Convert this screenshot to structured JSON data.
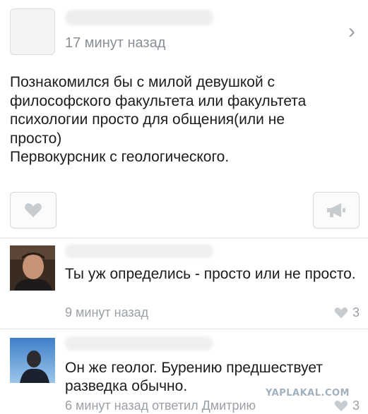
{
  "post": {
    "time": "17 минут назад",
    "text_lines": [
      "Познакомился бы с милой девушкой с",
      "философского факультета или факультета",
      "психологии просто для общения(или не",
      "просто)",
      "Первокурсник с геологического."
    ],
    "like_icon": "heart-icon",
    "share_icon": "megaphone-icon"
  },
  "comments": [
    {
      "text": "Ты уж определись - просто или не просто.",
      "meta": "9 минут назад",
      "likes": "3"
    },
    {
      "text": "Он же геолог. Бурению предшествует разведка обычно.",
      "meta": "6 минут назад ответил Дмитрию",
      "likes": "3"
    }
  ],
  "watermark": "YAPLAKAL.COM",
  "colors": {
    "meta": "#9aa0a6",
    "heart": "#c7ccd1",
    "text": "#1c1c1c"
  }
}
